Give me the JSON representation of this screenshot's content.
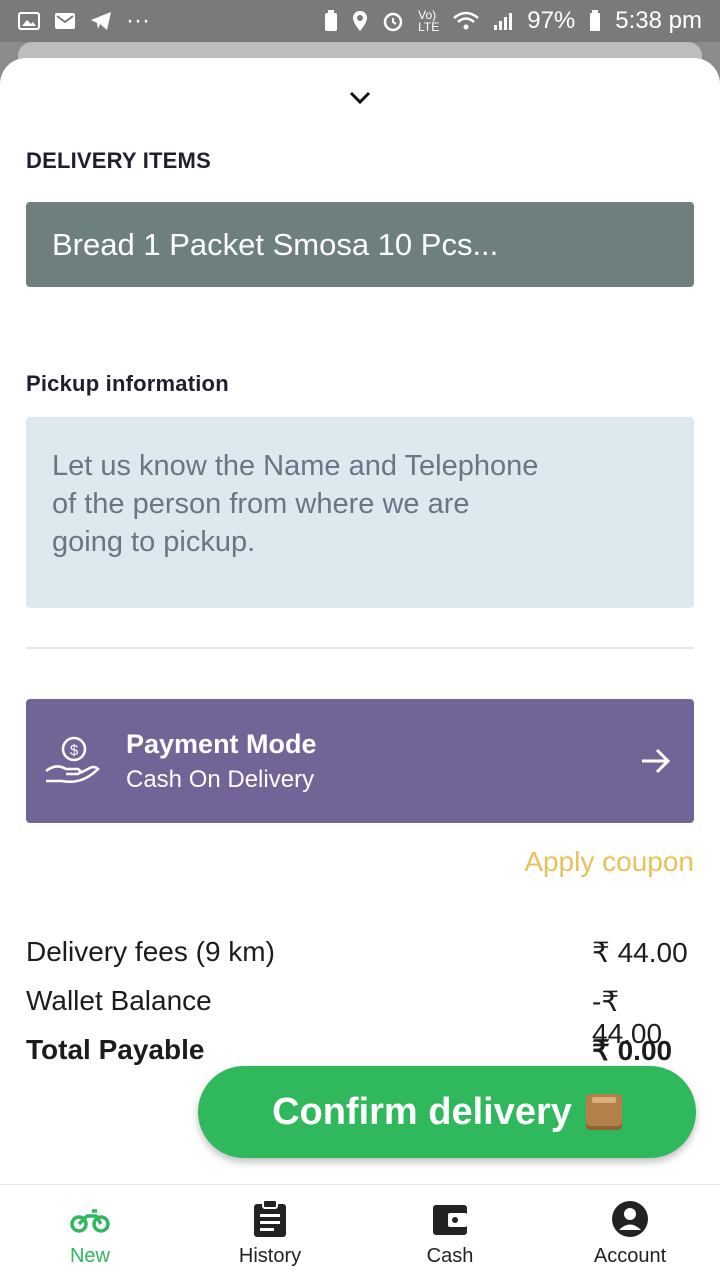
{
  "status_bar": {
    "battery": "97%",
    "time": "5:38 pm",
    "icons": [
      "image-icon",
      "gmail-icon",
      "telegram-icon",
      "more-dots-icon",
      "battery-saver-icon",
      "location-icon",
      "alarm-icon",
      "volte-icon",
      "wifi-icon",
      "signal-icon",
      "battery-icon"
    ]
  },
  "sheet": {
    "collapse_icon": "chevron-down-icon",
    "delivery_items": {
      "title": "DELIVERY ITEMS",
      "value": "Bread 1 Packet Smosa 10 Pcs..."
    },
    "pickup": {
      "title": "Pickup information",
      "placeholder": "Let us know the Name and Telephone\nof the person from where we are\ngoing to pickup."
    },
    "payment": {
      "icon": "hand-money-icon",
      "title": "Payment Mode",
      "value": "Cash On Delivery",
      "arrow_icon": "arrow-right-icon"
    },
    "coupon_label": "Apply coupon",
    "fees": [
      {
        "label": "Delivery fees (9 km)",
        "amount": "₹ 44.00"
      },
      {
        "label": "Wallet Balance",
        "amount": "-₹ 44.00"
      },
      {
        "label": "Total Payable",
        "amount": "₹ 0.00"
      }
    ],
    "confirm_button": "Confirm delivery"
  },
  "bottom_nav": [
    {
      "label": "New",
      "icon": "motorbike-icon",
      "active": true
    },
    {
      "label": "History",
      "icon": "clipboard-icon",
      "active": false
    },
    {
      "label": "Cash",
      "icon": "wallet-icon",
      "active": false
    },
    {
      "label": "Account",
      "icon": "account-circle-icon",
      "active": false
    }
  ],
  "colors": {
    "accent_green": "#2fb85c",
    "payment_purple": "#736497",
    "items_gray": "#6e7f80",
    "pickup_bg": "#dde9ee",
    "coupon_yellow": "#e8c15a"
  }
}
